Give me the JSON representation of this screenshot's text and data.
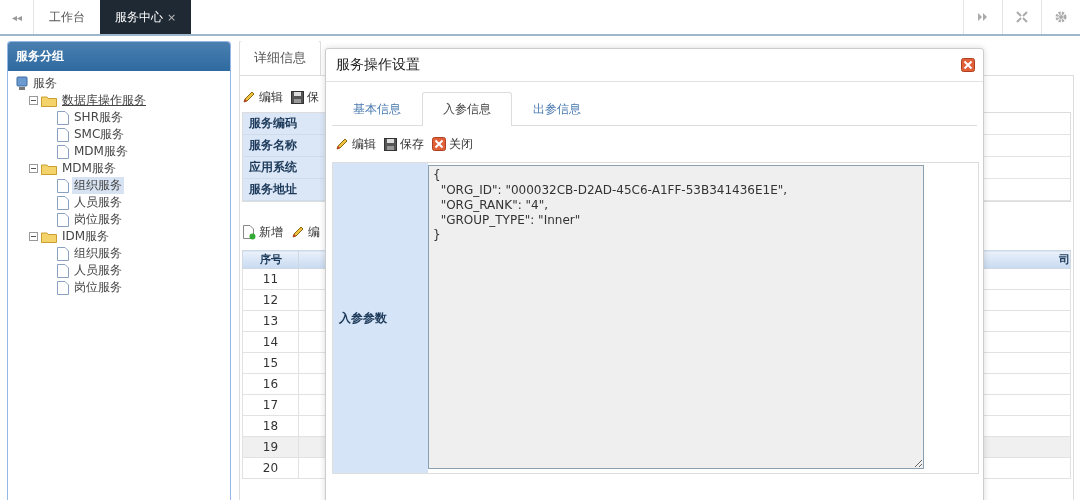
{
  "topbar": {
    "nav_left": "◂◂",
    "tabs": [
      {
        "label": "工作台",
        "selected": false
      },
      {
        "label": "服务中心",
        "selected": true,
        "close_label": "×"
      }
    ]
  },
  "sidebar": {
    "title": "服务分组",
    "tree": [
      {
        "label": "服务",
        "kind": "root",
        "selected": false,
        "children": [
          {
            "label": "数据库操作服务",
            "kind": "folder",
            "expanded": true,
            "underlined": true,
            "selected": false,
            "children": [
              {
                "label": "SHR服务",
                "kind": "leaf",
                "selected": false
              },
              {
                "label": "SMC服务",
                "kind": "leaf",
                "selected": false
              },
              {
                "label": "MDM服务",
                "kind": "leaf",
                "selected": false
              }
            ]
          },
          {
            "label": "MDM服务",
            "kind": "folder",
            "expanded": true,
            "underlined": false,
            "selected": false,
            "children": [
              {
                "label": "组织服务",
                "kind": "leaf",
                "selected": true
              },
              {
                "label": "人员服务",
                "kind": "leaf",
                "selected": false
              },
              {
                "label": "岗位服务",
                "kind": "leaf",
                "selected": false
              }
            ]
          },
          {
            "label": "IDM服务",
            "kind": "folder",
            "expanded": true,
            "underlined": false,
            "selected": false,
            "children": [
              {
                "label": "组织服务",
                "kind": "leaf",
                "selected": false
              },
              {
                "label": "人员服务",
                "kind": "leaf",
                "selected": false
              },
              {
                "label": "岗位服务",
                "kind": "leaf",
                "selected": false
              }
            ]
          }
        ]
      }
    ]
  },
  "main": {
    "tabs": [
      {
        "label": "详细信息",
        "selected": true
      }
    ],
    "toolbar": [
      {
        "kind": "edit",
        "label": "编辑"
      },
      {
        "kind": "save",
        "label": "保"
      }
    ],
    "form_labels": [
      "服务编码",
      "服务名称",
      "应用系统",
      "服务地址"
    ],
    "table_toolbar": [
      {
        "kind": "add",
        "label": "新增"
      },
      {
        "kind": "edit",
        "label": "编"
      }
    ],
    "table": {
      "columns": [
        "序号",
        "司"
      ],
      "rows": [
        {
          "number": "11",
          "selected": false
        },
        {
          "number": "12",
          "selected": false
        },
        {
          "number": "13",
          "selected": false
        },
        {
          "number": "14",
          "selected": false
        },
        {
          "number": "15",
          "selected": false
        },
        {
          "number": "16",
          "selected": false
        },
        {
          "number": "17",
          "selected": false
        },
        {
          "number": "18",
          "selected": false
        },
        {
          "number": "19",
          "selected": true
        },
        {
          "number": "20",
          "selected": false
        }
      ]
    }
  },
  "dialog": {
    "title": "服务操作设置",
    "tabs": [
      {
        "label": "基本信息",
        "selected": false
      },
      {
        "label": "入参信息",
        "selected": true
      },
      {
        "label": "出参信息",
        "selected": false
      }
    ],
    "toolbar": [
      {
        "kind": "edit",
        "label": "编辑"
      },
      {
        "kind": "save",
        "label": "保存"
      },
      {
        "kind": "close",
        "label": "关闭"
      }
    ],
    "field_label": "入参参数",
    "field_value": "{\n  \"ORG_ID\": \"000032CB-D2AD-45C6-A1FF-53B341436E1E\",\n  \"ORG_RANK\": \"4\",\n  \"GROUP_TYPE\": \"Inner\"\n}"
  }
}
